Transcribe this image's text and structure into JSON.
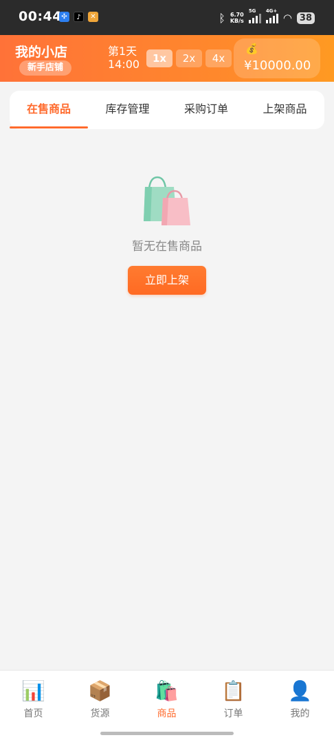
{
  "status_bar": {
    "time": "00:44",
    "speed_value": "6.70",
    "speed_unit": "KB/s",
    "signal_1_label": "5G",
    "signal_2_label": "4G+",
    "battery": "38"
  },
  "header": {
    "shop_name": "我的小店",
    "shop_level": "新手店铺",
    "day_label": "第1天",
    "time_label": "14:00",
    "speed_options": [
      "1x",
      "2x",
      "4x"
    ],
    "active_speed": "1x",
    "money_icon": "money-bag-icon",
    "money": "¥10000.00"
  },
  "tabs": {
    "items": [
      "在售商品",
      "库存管理",
      "采购订单",
      "上架商品"
    ],
    "active": "在售商品"
  },
  "empty_state": {
    "icon": "shopping-bags-icon",
    "message": "暂无在售商品",
    "button_label": "立即上架"
  },
  "bottom_nav": {
    "items": [
      {
        "label": "首页",
        "icon": "chart-icon"
      },
      {
        "label": "货源",
        "icon": "package-icon"
      },
      {
        "label": "商品",
        "icon": "shopping-bags-icon"
      },
      {
        "label": "订单",
        "icon": "clipboard-icon"
      },
      {
        "label": "我的",
        "icon": "user-icon"
      }
    ],
    "active": "商品"
  },
  "colors": {
    "accent": "#ff6a2c",
    "header_start": "#ff7238",
    "header_end": "#ff9a22"
  }
}
